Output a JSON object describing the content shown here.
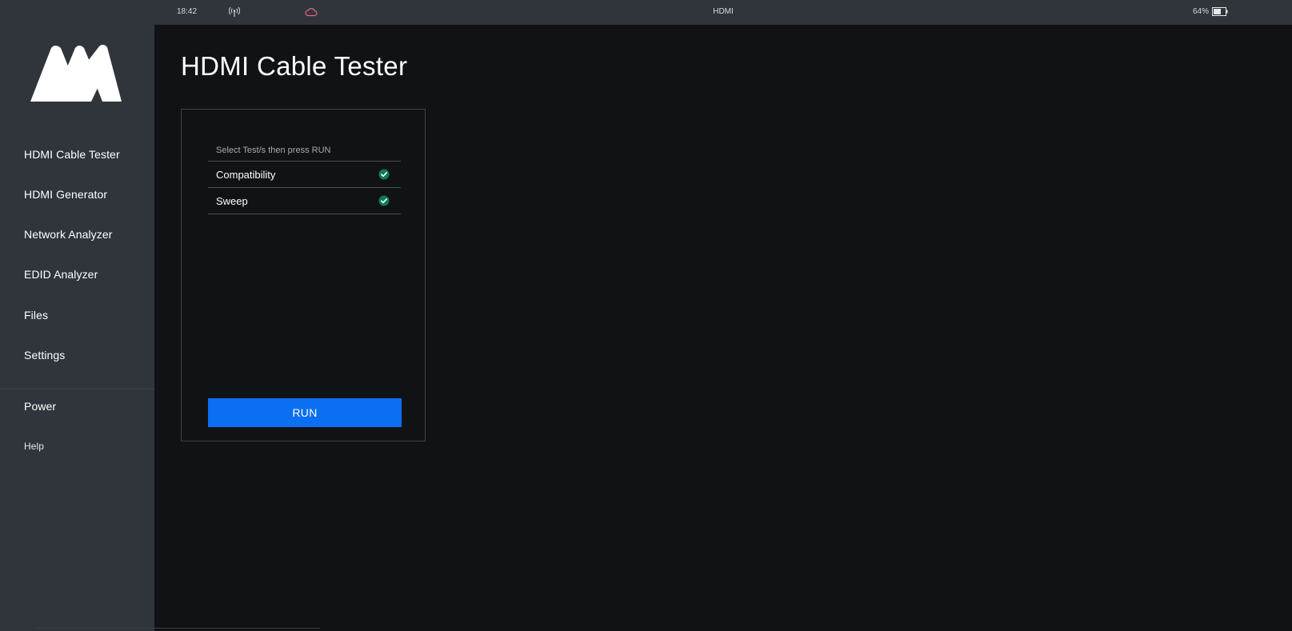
{
  "statusbar": {
    "time": "18:42",
    "center": "HDMI",
    "battery_pct": "64%",
    "icons": [
      "antenna-signal-icon",
      "cloud-icon",
      "battery-icon"
    ]
  },
  "sidebar": {
    "logo": "brand-logo",
    "items": [
      {
        "label": "HDMI Cable Tester"
      },
      {
        "label": "HDMI Generator"
      },
      {
        "label": "Network Analyzer"
      },
      {
        "label": "EDID Analyzer"
      },
      {
        "label": "Files"
      },
      {
        "label": "Settings"
      }
    ],
    "power_label": "Power",
    "help_label": "Help"
  },
  "main": {
    "title": "HDMI Cable Tester",
    "panel": {
      "hint": "Select Test/s then press RUN",
      "tests": [
        {
          "label": "Compatibility",
          "selected": true
        },
        {
          "label": "Sweep",
          "selected": true
        }
      ],
      "run_label": "RUN"
    }
  },
  "colors": {
    "sidebar_bg": "#30353b",
    "main_bg": "#111215",
    "accent": "#0a6ff0",
    "check_green": "#0e7a55",
    "cloud": "#e06a78"
  }
}
